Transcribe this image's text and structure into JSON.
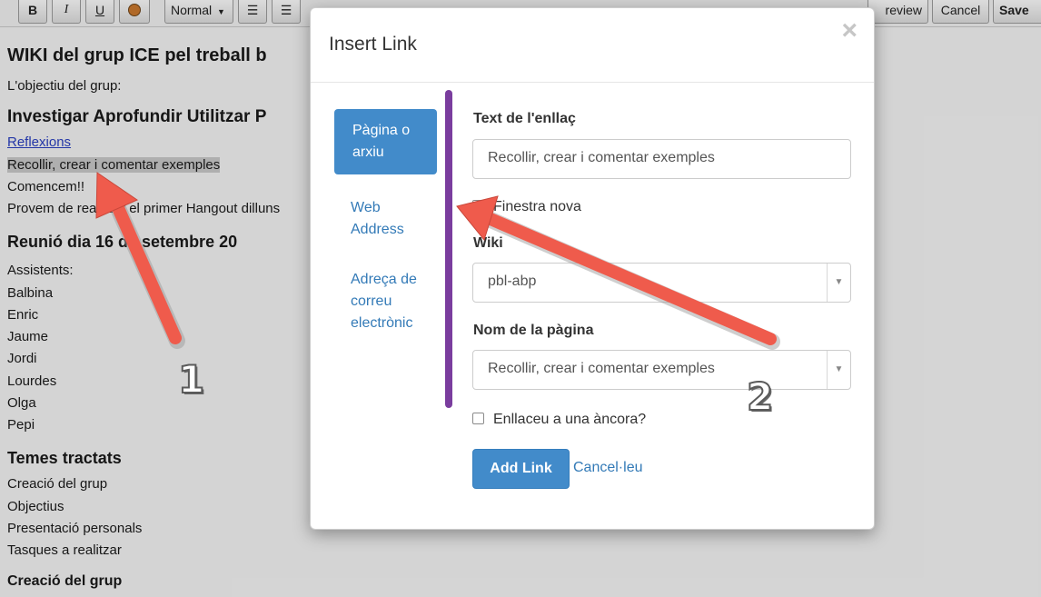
{
  "toolbar": {
    "bold": "B",
    "italic": "I",
    "underline": "U",
    "style": "Normal",
    "preview": "review",
    "cancel": "Cancel",
    "save": "Save"
  },
  "editor": {
    "lines": [
      "WIKI del grup ICE pel treball b",
      "L'objectiu del grup:",
      "Investigar Aprofundir Utilitzar P",
      "Reflexions",
      "Recollir, crear i comentar exemples",
      "Comencem!!",
      "Provem de realitzar el primer Hangout dilluns",
      "Reunió dia 16 de setembre 20",
      "Assistents:",
      "Balbina",
      "Enric",
      "Jaume",
      "Jordi",
      "Lourdes",
      "Olga",
      "Pepi",
      "Temes tractats",
      "Creació del grup",
      "Objectius",
      "Presentació personals",
      "Tasques a realitzar",
      "Creació del grup"
    ]
  },
  "modal": {
    "title": "Insert Link",
    "close_symbol": "×",
    "nav": [
      "Pàgina o arxiu",
      "Web Address",
      "Adreça de correu electrònic"
    ],
    "link_text_label": "Text de l'enllaç",
    "link_text_value": "Recollir, crear i comentar exemples",
    "new_window_label": "Finestra nova",
    "wiki_label": "Wiki",
    "wiki_value": "pbl-abp",
    "page_name_label": "Nom de la pàgina",
    "page_name_value": "Recollir, crear i comentar exemples",
    "anchor_label": "Enllaceu a una àncora?",
    "add_button": "Add Link",
    "cancel_link": "Cancel·leu"
  },
  "annotations": {
    "label_1": "1",
    "label_2": "2",
    "arrow_color": "#ef5b4c",
    "divider_color": "#7a3d9e"
  },
  "colors": {
    "primary": "#428bca",
    "link": "#337ab7"
  }
}
